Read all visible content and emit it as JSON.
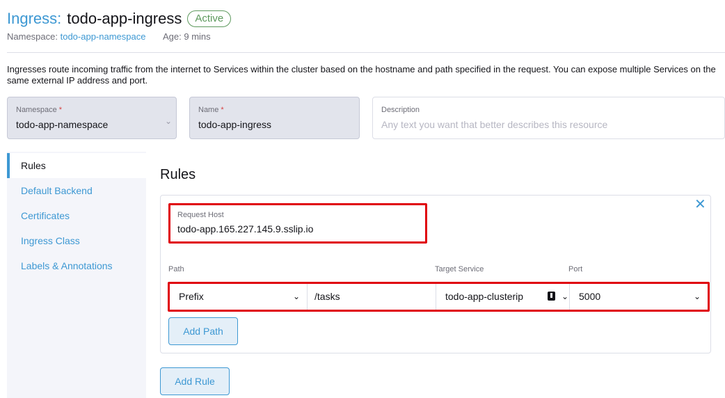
{
  "header": {
    "type_label": "Ingress:",
    "name": "todo-app-ingress",
    "status": "Active",
    "namespace_label": "Namespace:",
    "namespace_value": "todo-app-namespace",
    "age_label": "Age: 9 mins"
  },
  "description_text": "Ingresses route incoming traffic from the internet to Services within the cluster based on the hostname and path specified in the request. You can expose multiple Services on the same external IP address and port.",
  "form": {
    "namespace": {
      "label": "Namespace",
      "required": "*",
      "value": "todo-app-namespace"
    },
    "name": {
      "label": "Name",
      "required": "*",
      "value": "todo-app-ingress"
    },
    "description": {
      "label": "Description",
      "placeholder": "Any text you want that better describes this resource"
    }
  },
  "tabs": [
    {
      "label": "Rules",
      "active": true
    },
    {
      "label": "Default Backend"
    },
    {
      "label": "Certificates"
    },
    {
      "label": "Ingress Class"
    },
    {
      "label": "Labels & Annotations"
    }
  ],
  "rules": {
    "title": "Rules",
    "request_host_label": "Request Host",
    "request_host_value": "todo-app.165.227.145.9.sslip.io",
    "columns": {
      "path": "Path",
      "target_service": "Target Service",
      "port": "Port"
    },
    "path_row": {
      "path_type": "Prefix",
      "path": "/tasks",
      "target_service": "todo-app-clusterip",
      "port": "5000"
    },
    "add_path_label": "Add Path",
    "add_rule_label": "Add Rule"
  },
  "icons": [
    "close-icon",
    "chevron-down-icon",
    "flag-icon"
  ],
  "colors": {
    "accent": "#3d98d3",
    "status_active": "#5d995d",
    "highlight": "#e0000b"
  }
}
